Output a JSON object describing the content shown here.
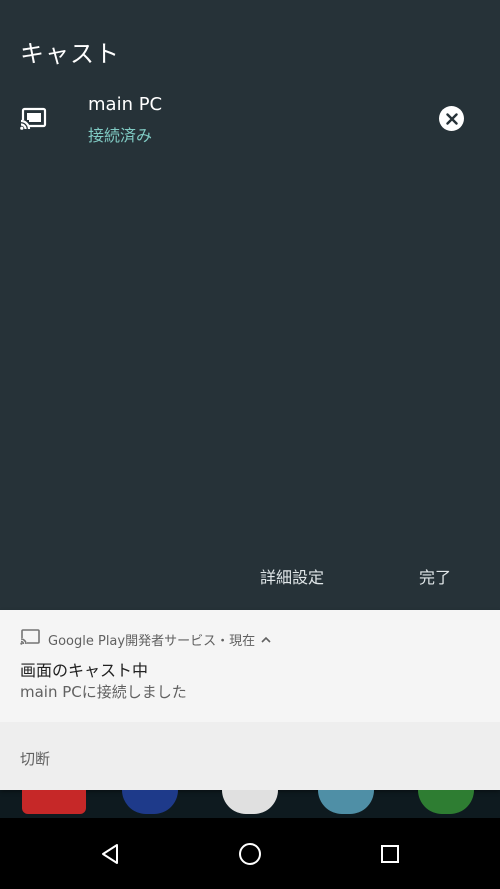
{
  "cast_dialog": {
    "title": "キャスト",
    "device": {
      "name": "main PC",
      "status": "接続済み",
      "icon": "cast-connected-icon",
      "action_icon": "close-circle-icon"
    },
    "buttons": {
      "settings": "詳細設定",
      "done": "完了"
    }
  },
  "notification": {
    "app_icon": "cast-icon",
    "header": "Google Play開発者サービス・現在",
    "expand_icon": "chevron-up-icon",
    "title": "画面のキャスト中",
    "text": "main PCに接続しました",
    "action": "切断"
  },
  "navbar": {
    "back_icon": "back-triangle-icon",
    "home_icon": "home-circle-icon",
    "recents_icon": "recents-square-icon"
  },
  "colors": {
    "panel_bg": "#263238",
    "accent": "#80cbc4",
    "notification_bg": "#f5f5f5"
  }
}
